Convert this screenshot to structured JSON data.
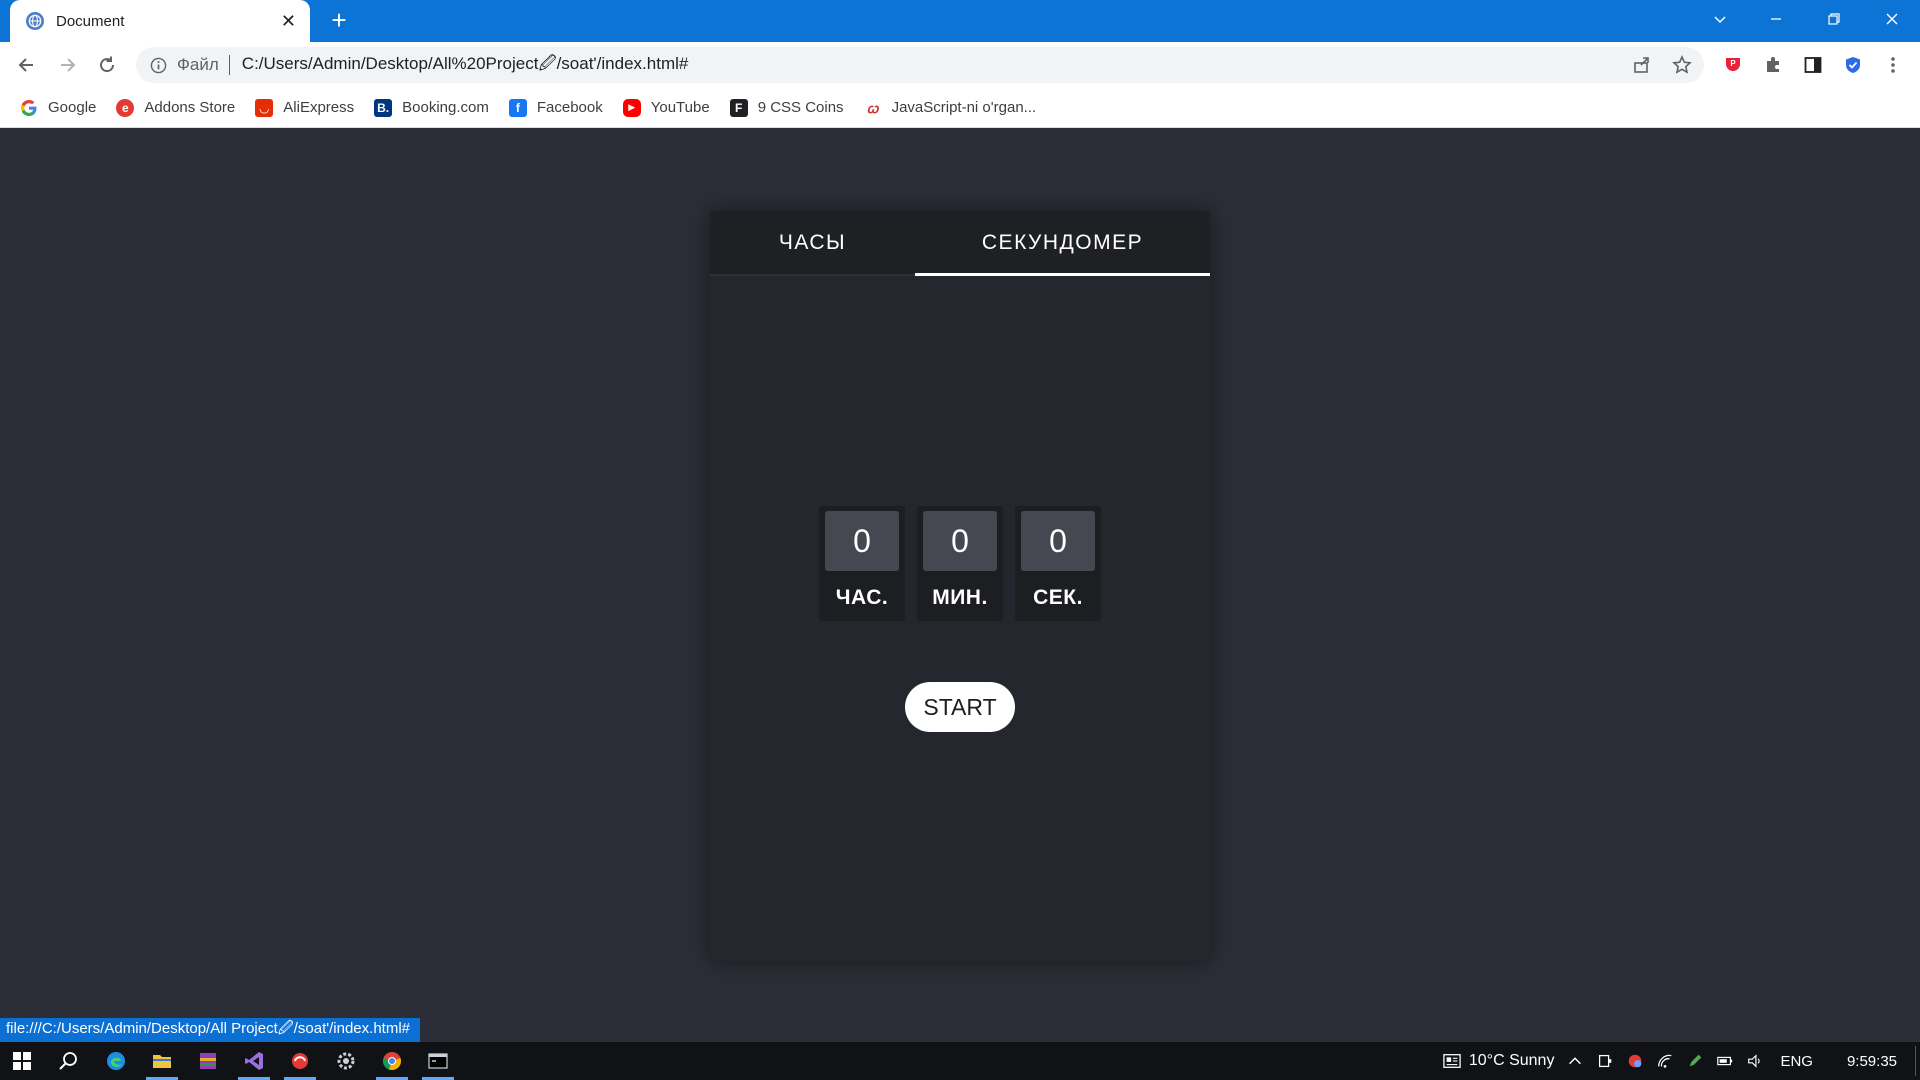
{
  "browser": {
    "tab": {
      "title": "Document",
      "favicon": "globe-icon"
    },
    "omnibox": {
      "scheme_label": "Файл",
      "url": "C:/Users/Admin/Desktop/All%20Project🖉/soat'/index.html#"
    },
    "bookmarks": [
      {
        "label": "Google",
        "icon": "google-icon",
        "color": "#ea4335"
      },
      {
        "label": "Addons Store",
        "icon": "addons-store-icon",
        "color": "#e53935"
      },
      {
        "label": "AliExpress",
        "icon": "aliexpress-icon",
        "color": "#e62e04"
      },
      {
        "label": "Booking.com",
        "icon": "booking-icon",
        "color": "#003580"
      },
      {
        "label": "Facebook",
        "icon": "facebook-icon",
        "color": "#1877f2"
      },
      {
        "label": "YouTube",
        "icon": "youtube-icon",
        "color": "#ff0000"
      },
      {
        "label": "9 CSS Coins",
        "icon": "css-coins-icon",
        "color": "#202124"
      },
      {
        "label": "JavaScript-ni o'rgan...",
        "icon": "javascript-icon",
        "color": "#d32f2f"
      }
    ],
    "status_url": "file:///C:/Users/Admin/Desktop/All Project🖉/soat'/index.html#"
  },
  "app": {
    "tabs": [
      {
        "label": "ЧАСЫ",
        "active": false
      },
      {
        "label": "СЕКУНДОМЕР",
        "active": true
      }
    ],
    "stopwatch": {
      "hours": {
        "value": "0",
        "label": "ЧАС."
      },
      "minutes": {
        "value": "0",
        "label": "МИН."
      },
      "seconds": {
        "value": "0",
        "label": "СЕК."
      }
    },
    "start_label": "START"
  },
  "taskbar": {
    "weather": "10°C  Sunny",
    "language": "ENG",
    "time": "9:59:35"
  },
  "colors": {
    "tabstrip": "#0b74d4",
    "page_bg": "#2b2e36",
    "card_bg": "#24272d",
    "digit_bg": "#454850",
    "status_bar": "#0c6fd4"
  }
}
